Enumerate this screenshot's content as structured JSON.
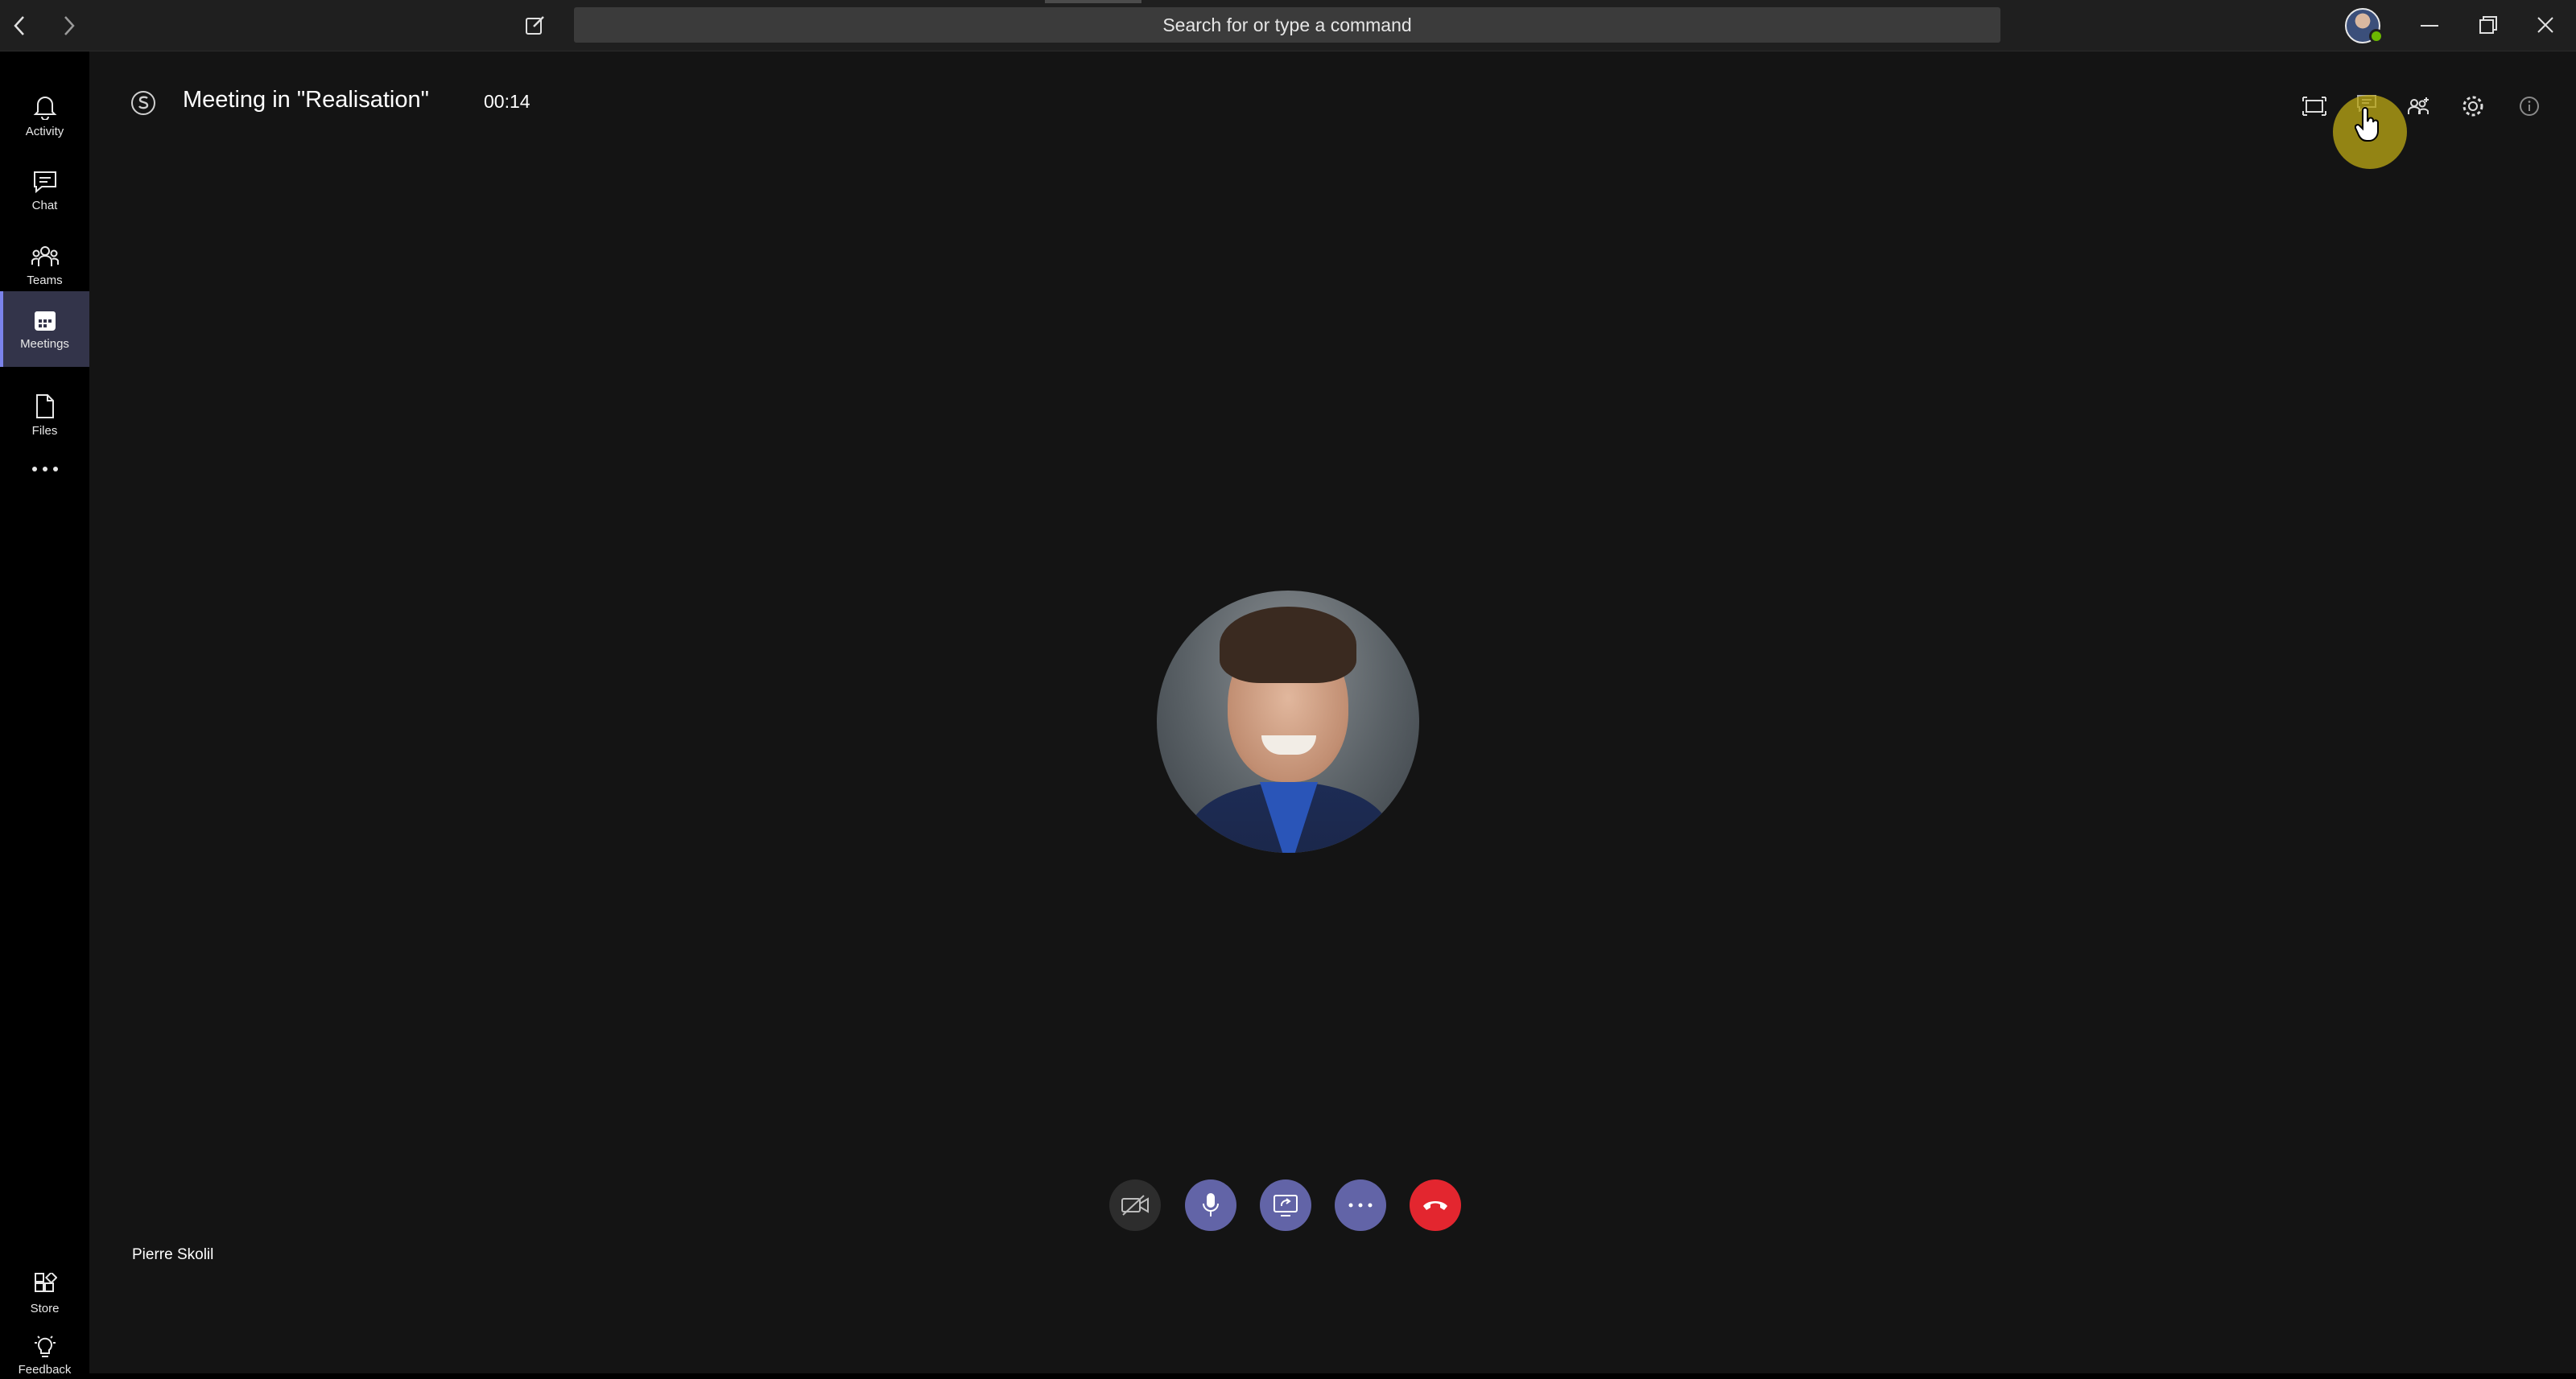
{
  "titlebar": {
    "search_placeholder": "Search for or type a command",
    "icons": [
      "back-arrow-icon",
      "forward-arrow-icon",
      "compose-icon",
      "minimize-icon",
      "restore-icon",
      "close-icon"
    ]
  },
  "rail": {
    "items": [
      {
        "label": "Activity",
        "icon": "bell-icon"
      },
      {
        "label": "Chat",
        "icon": "chat-icon"
      },
      {
        "label": "Teams",
        "icon": "teams-icon"
      },
      {
        "label": "Meetings",
        "icon": "calendar-icon",
        "active": true
      },
      {
        "label": "Files",
        "icon": "file-icon"
      },
      {
        "label": "…",
        "icon": "more-icon"
      }
    ],
    "bottom_items": [
      {
        "label": "Store",
        "icon": "store-icon"
      },
      {
        "label": "Feedback",
        "icon": "lightbulb-icon"
      }
    ]
  },
  "meeting": {
    "title": "Meeting in \"Realisation\"",
    "timer": "00:14",
    "participant_name": "Pierre Skolil",
    "header_icons": [
      "fullscreen-icon",
      "chat-icon",
      "participants-icon",
      "settings-icon",
      "info-icon"
    ],
    "controls": [
      "camera-off-icon",
      "microphone-icon",
      "share-screen-icon",
      "more-actions-icon",
      "hang-up-icon"
    ]
  },
  "colors": {
    "accent": "#6264a7",
    "hangup": "#e3262f",
    "presence": "#6bb700",
    "stage_bg": "#141414"
  }
}
